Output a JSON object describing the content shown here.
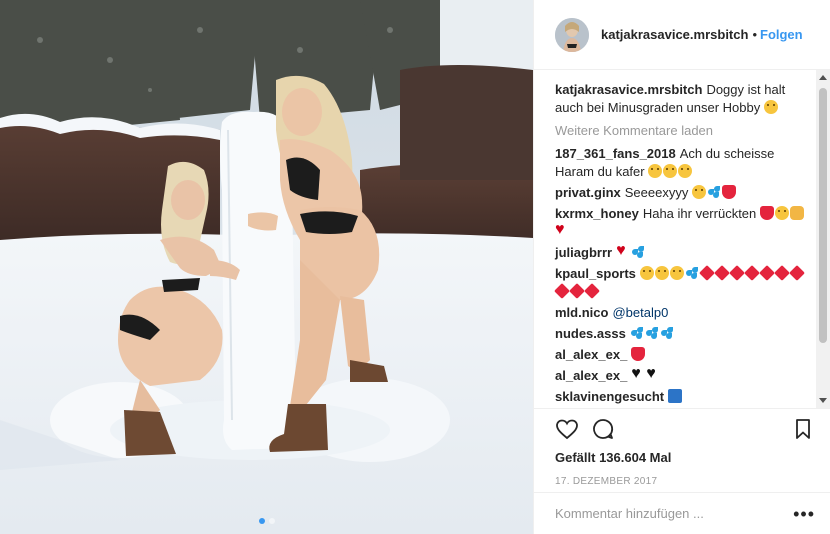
{
  "header": {
    "username": "katjakrasavice.mrsbitch",
    "separator": "•",
    "follow_label": "Folgen"
  },
  "caption": {
    "username": "katjakrasavice.mrsbitch",
    "text": "Doggy ist halt auch bei Minusgraden unser Hobby",
    "emoji": [
      "face"
    ]
  },
  "load_more_label": "Weitere Kommentare laden",
  "comments": [
    {
      "user": "187_361_fans_2018",
      "text": "Ach du scheisse Haram du kafer",
      "emoji": [
        "face",
        "face",
        "face"
      ]
    },
    {
      "user": "privat.ginx",
      "text": "Seeeexyyy",
      "emoji": [
        "face",
        "drops",
        "tongue"
      ]
    },
    {
      "user": "kxrmx_honey",
      "text": "Haha ihr verrückten",
      "emoji": [
        "tongue",
        "face",
        "hand",
        "heart"
      ]
    },
    {
      "user": "juliagbrrr",
      "text": "",
      "emoji": [
        "heart",
        "drops"
      ]
    },
    {
      "user": "kpaul_sports",
      "text": "",
      "emoji": [
        "face",
        "face",
        "face",
        "drops",
        "anger",
        "anger",
        "anger",
        "anger",
        "anger",
        "anger",
        "anger",
        "anger",
        "anger",
        "anger"
      ]
    },
    {
      "user": "mld.nico",
      "text": "@betalp0",
      "emoji": []
    },
    {
      "user": "nudes.asss",
      "text": "",
      "emoji": [
        "drops",
        "drops",
        "drops"
      ]
    },
    {
      "user": "al_alex_ex_",
      "text": "",
      "emoji": [
        "tongue"
      ]
    },
    {
      "user": "al_alex_ex_",
      "text": "",
      "emoji": [
        "blackheart",
        "blackheart"
      ]
    },
    {
      "user": "sklavinengesucht",
      "text": "",
      "emoji": [
        "banner"
      ]
    }
  ],
  "likes_label": "Gefällt 136.604 Mal",
  "date_label": "17. DEZEMBER 2017",
  "comment_input": {
    "placeholder": "Kommentar hinzufügen ...",
    "value": ""
  },
  "options_label": "•••",
  "colors": {
    "accent": "#3897f0",
    "text": "#262626",
    "muted": "#999999",
    "border": "#efefef"
  },
  "icons": [
    "heart-icon",
    "comment-icon",
    "bookmark-icon",
    "more-options-icon"
  ],
  "carousel": {
    "count": 2,
    "active": 1
  }
}
